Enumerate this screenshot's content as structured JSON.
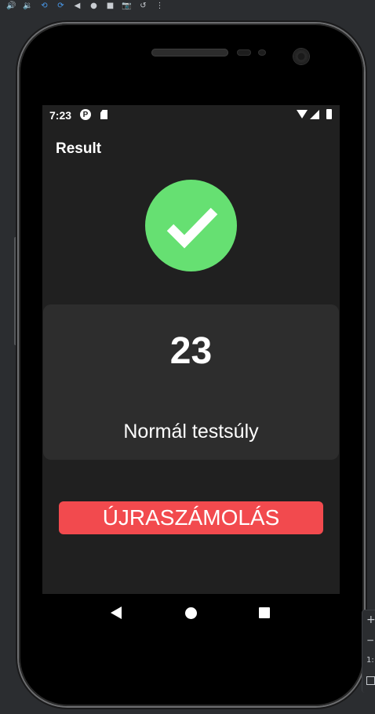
{
  "emulator_toolbar": {
    "tools": [
      {
        "icon": "volume-up-icon",
        "glyph": "🔊"
      },
      {
        "icon": "volume-down-icon",
        "glyph": "🔉"
      },
      {
        "icon": "rotate-left-icon",
        "glyph": "⟲"
      },
      {
        "icon": "rotate-right-icon",
        "glyph": "⟳"
      },
      {
        "icon": "back-icon",
        "glyph": "◀"
      },
      {
        "icon": "home-icon",
        "glyph": "●"
      },
      {
        "icon": "overview-icon",
        "glyph": "■"
      },
      {
        "icon": "screenshot-icon",
        "glyph": "📷"
      },
      {
        "icon": "replay-icon",
        "glyph": "↺"
      },
      {
        "icon": "more-icon",
        "glyph": "⋮"
      }
    ]
  },
  "status_bar": {
    "time": "7:23",
    "p_glyph": "P"
  },
  "app_bar": {
    "title": "Result"
  },
  "result": {
    "status_icon": "check-circle-icon",
    "bmi_value": "23",
    "category": "Normál testsúly"
  },
  "actions": {
    "recalculate_label": "ÚJRASZÁMOLÁS"
  },
  "side_panel": {
    "plus_glyph": "+",
    "minus_glyph": "−",
    "ratio_label": "1:"
  },
  "colors": {
    "screen_background": "#202020",
    "card_background": "#2d2d2d",
    "check_green": "#66e072",
    "button_red": "#f24a4e",
    "text": "#ffffff"
  }
}
